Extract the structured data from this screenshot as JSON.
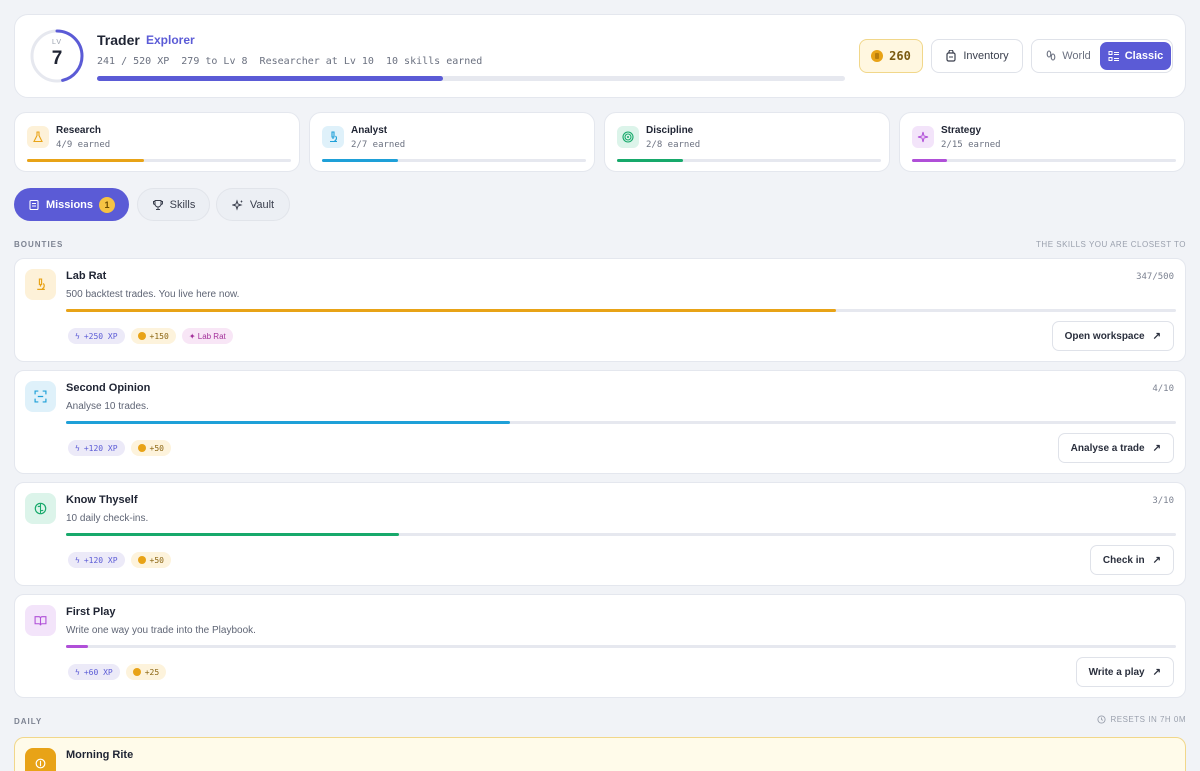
{
  "header": {
    "level_label": "LV",
    "level": "7",
    "title": "Trader",
    "rank": "Explorer",
    "stats": "241 / 520 XP  279 to Lv 8  Researcher at Lv 10  10 skills earned",
    "xp_progress": 0.463,
    "coins": "260",
    "inventory_label": "Inventory",
    "world_label": "World",
    "classic_label": "Classic"
  },
  "categories": [
    {
      "name": "Research",
      "count": "4/9 earned",
      "progress": 0.444,
      "color": "#e8a317",
      "icon": "flask-icon"
    },
    {
      "name": "Analyst",
      "count": "2/7 earned",
      "progress": 0.286,
      "color": "#1ea0d8",
      "icon": "microscope-icon"
    },
    {
      "name": "Discipline",
      "count": "2/8 earned",
      "progress": 0.25,
      "color": "#17a96b",
      "icon": "target-icon"
    },
    {
      "name": "Strategy",
      "count": "2/15 earned",
      "progress": 0.133,
      "color": "#b04fd8",
      "icon": "sparkle-icon"
    }
  ],
  "tabs": {
    "missions": "Missions",
    "missions_badge": "1",
    "skills": "Skills",
    "vault": "Vault"
  },
  "bounties_section": {
    "label": "BOUNTIES",
    "right_label": "THE SKILLS YOU ARE CLOSEST TO"
  },
  "bounties": [
    {
      "title": "Lab Rat",
      "desc": "500 backtest trades. You live here now.",
      "progress_text": "347/500",
      "progress": 0.694,
      "color": "#e8a317",
      "xp": "+250 XP",
      "coins": "+150",
      "tag": "✦ Lab Rat",
      "button": "Open workspace",
      "icon": "microscope-icon"
    },
    {
      "title": "Second Opinion",
      "desc": "Analyse 10 trades.",
      "progress_text": "4/10",
      "progress": 0.4,
      "color": "#1ea0d8",
      "xp": "+120 XP",
      "coins": "+50",
      "button": "Analyse a trade",
      "icon": "scan-icon"
    },
    {
      "title": "Know Thyself",
      "desc": "10 daily check-ins.",
      "progress_text": "3/10",
      "progress": 0.3,
      "color": "#17a96b",
      "xp": "+120 XP",
      "coins": "+50",
      "button": "Check in",
      "icon": "brain-icon"
    },
    {
      "title": "First Play",
      "desc": "Write one way you trade into the Playbook.",
      "progress_text": "",
      "progress": 0.02,
      "color": "#b04fd8",
      "xp": "+60 XP",
      "coins": "+25",
      "button": "Write a play",
      "icon": "book-icon"
    }
  ],
  "daily_section": {
    "label": "DAILY",
    "reset": "RESETS IN 7H 0M"
  },
  "daily": {
    "title": "Morning Rite",
    "icon": "sun-icon"
  }
}
